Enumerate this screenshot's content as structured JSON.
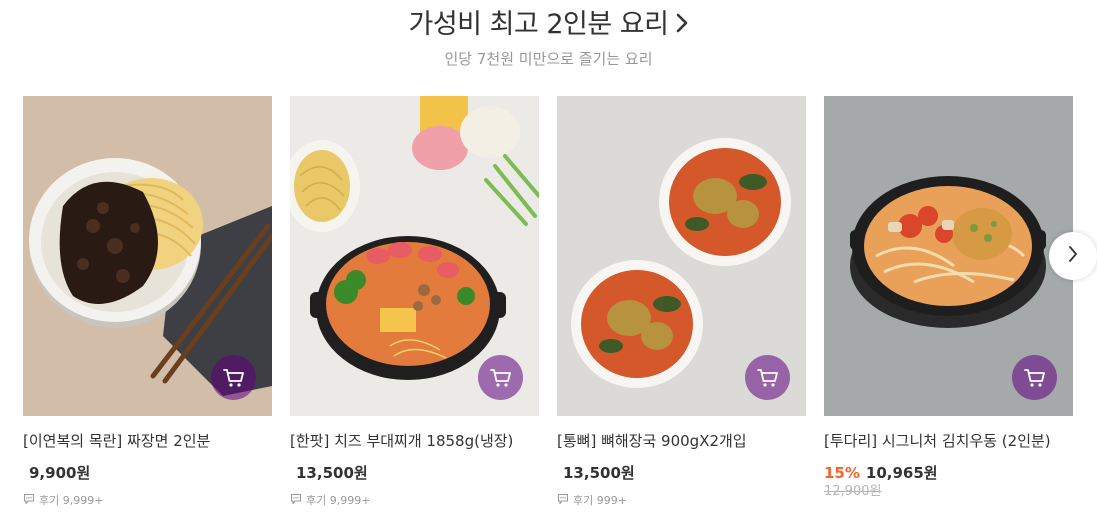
{
  "section": {
    "title": "가성비 최고 2인분 요리",
    "subtitle": "인당 7천원 미만으로 즐기는 요리"
  },
  "products": [
    {
      "name": "[이연복의 목란] 짜장면 2인분",
      "price": "9,900원",
      "discount": "",
      "original_price": "",
      "review_label": "후기",
      "review_count": "9,999+"
    },
    {
      "name": "[한팟] 치즈 부대찌개 1858g(냉장)",
      "price": "13,500원",
      "discount": "",
      "original_price": "",
      "review_label": "후기",
      "review_count": "9,999+"
    },
    {
      "name": "[통뼈] 뼈해장국 900gX2개입",
      "price": "13,500원",
      "discount": "",
      "original_price": "",
      "review_label": "후기",
      "review_count": "999+"
    },
    {
      "name": "[투다리] 시그니처 김치우동 (2인분)",
      "price": "10,965원",
      "discount": "15%",
      "original_price": "12,900원",
      "review_label": "",
      "review_count": ""
    }
  ],
  "colors": {
    "accent_purple": "#5f0080",
    "discount_orange": "#fa622f",
    "muted_text": "#999999"
  },
  "icons": {
    "title_arrow": "chevron-right-icon",
    "cart": "cart-icon",
    "review": "speech-bubble-icon",
    "carousel_next": "chevron-right-icon"
  }
}
